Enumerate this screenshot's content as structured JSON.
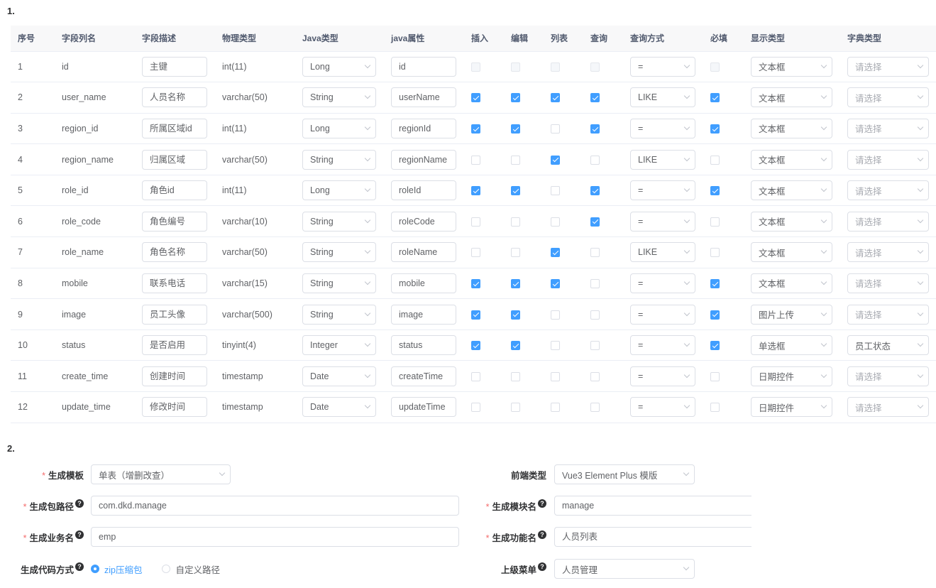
{
  "section1_label": "1.",
  "section2_label": "2.",
  "table": {
    "headers": [
      "序号",
      "字段列名",
      "字段描述",
      "物理类型",
      "Java类型",
      "java属性",
      "插入",
      "编辑",
      "列表",
      "查询",
      "查询方式",
      "必填",
      "显示类型",
      "字典类型"
    ],
    "rows": [
      {
        "no": "1",
        "col": "id",
        "desc": "主键",
        "ptype": "int(11)",
        "jtype": "Long",
        "jattr": "id",
        "insert": false,
        "edit": false,
        "list": false,
        "query": false,
        "qmode": "=",
        "required": false,
        "dtype": "文本框",
        "dict": "请选择",
        "disabled": true
      },
      {
        "no": "2",
        "col": "user_name",
        "desc": "人员名称",
        "ptype": "varchar(50)",
        "jtype": "String",
        "jattr": "userName",
        "insert": true,
        "edit": true,
        "list": true,
        "query": true,
        "qmode": "LIKE",
        "required": true,
        "dtype": "文本框",
        "dict": "请选择"
      },
      {
        "no": "3",
        "col": "region_id",
        "desc": "所属区域id",
        "ptype": "int(11)",
        "jtype": "Long",
        "jattr": "regionId",
        "insert": true,
        "edit": true,
        "list": false,
        "query": true,
        "qmode": "=",
        "required": true,
        "dtype": "文本框",
        "dict": "请选择"
      },
      {
        "no": "4",
        "col": "region_name",
        "desc": "归属区域",
        "ptype": "varchar(50)",
        "jtype": "String",
        "jattr": "regionName",
        "insert": false,
        "edit": false,
        "list": true,
        "query": false,
        "qmode": "LIKE",
        "required": false,
        "dtype": "文本框",
        "dict": "请选择"
      },
      {
        "no": "5",
        "col": "role_id",
        "desc": "角色id",
        "ptype": "int(11)",
        "jtype": "Long",
        "jattr": "roleId",
        "insert": true,
        "edit": true,
        "list": false,
        "query": true,
        "qmode": "=",
        "required": true,
        "dtype": "文本框",
        "dict": "请选择"
      },
      {
        "no": "6",
        "col": "role_code",
        "desc": "角色编号",
        "ptype": "varchar(10)",
        "jtype": "String",
        "jattr": "roleCode",
        "insert": false,
        "edit": false,
        "list": false,
        "query": true,
        "qmode": "=",
        "required": false,
        "dtype": "文本框",
        "dict": "请选择"
      },
      {
        "no": "7",
        "col": "role_name",
        "desc": "角色名称",
        "ptype": "varchar(50)",
        "jtype": "String",
        "jattr": "roleName",
        "insert": false,
        "edit": false,
        "list": true,
        "query": false,
        "qmode": "LIKE",
        "required": false,
        "dtype": "文本框",
        "dict": "请选择"
      },
      {
        "no": "8",
        "col": "mobile",
        "desc": "联系电话",
        "ptype": "varchar(15)",
        "jtype": "String",
        "jattr": "mobile",
        "insert": true,
        "edit": true,
        "list": true,
        "query": false,
        "qmode": "=",
        "required": true,
        "dtype": "文本框",
        "dict": "请选择"
      },
      {
        "no": "9",
        "col": "image",
        "desc": "员工头像",
        "ptype": "varchar(500)",
        "jtype": "String",
        "jattr": "image",
        "insert": true,
        "edit": true,
        "list": false,
        "query": false,
        "qmode": "=",
        "required": true,
        "dtype": "图片上传",
        "dict": "请选择"
      },
      {
        "no": "10",
        "col": "status",
        "desc": "是否启用",
        "ptype": "tinyint(4)",
        "jtype": "Integer",
        "jattr": "status",
        "insert": true,
        "edit": true,
        "list": false,
        "query": false,
        "qmode": "=",
        "required": true,
        "dtype": "单选框",
        "dict": "员工状态"
      },
      {
        "no": "11",
        "col": "create_time",
        "desc": "创建时间",
        "ptype": "timestamp",
        "jtype": "Date",
        "jattr": "createTime",
        "insert": false,
        "edit": false,
        "list": false,
        "query": false,
        "qmode": "=",
        "required": false,
        "dtype": "日期控件",
        "dict": "请选择"
      },
      {
        "no": "12",
        "col": "update_time",
        "desc": "修改时间",
        "ptype": "timestamp",
        "jtype": "Date",
        "jattr": "updateTime",
        "insert": false,
        "edit": false,
        "list": false,
        "query": false,
        "qmode": "=",
        "required": false,
        "dtype": "日期控件",
        "dict": "请选择"
      }
    ]
  },
  "form": {
    "template_label": "生成模板",
    "template_value": "单表（增删改查）",
    "frontend_label": "前端类型",
    "frontend_value": "Vue3 Element Plus 模版",
    "package_label": "生成包路径",
    "package_value": "com.dkd.manage",
    "module_label": "生成模块名",
    "module_value": "manage",
    "business_label": "生成业务名",
    "business_value": "emp",
    "function_label": "生成功能名",
    "function_value": "人员列表",
    "gen_type_label": "生成代码方式",
    "gen_type_options": [
      "zip压缩包",
      "自定义路径"
    ],
    "gen_type_selected": "zip压缩包",
    "parent_menu_label": "上级菜单",
    "parent_menu_value": "人员管理",
    "help_glyph": "?"
  },
  "colors": {
    "accent": "#409eff",
    "required": "#f56c6c",
    "header_bg": "#f8f8f9"
  }
}
